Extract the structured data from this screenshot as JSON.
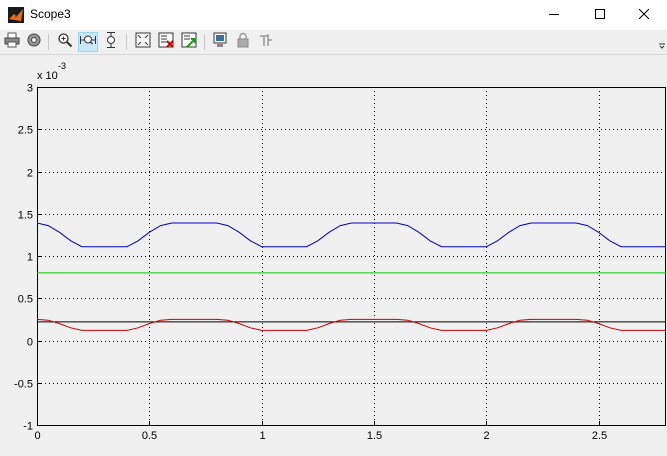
{
  "window": {
    "title": "Scope3",
    "icon": "matlab-icon",
    "controls": [
      "minimize-icon",
      "maximize-icon",
      "close-icon"
    ]
  },
  "toolbar": {
    "buttons": [
      {
        "name": "print-icon"
      },
      {
        "name": "parameters-gear-icon"
      },
      {
        "name": "zoom-in-icon"
      },
      {
        "name": "zoom-x-axis-icon",
        "active": true
      },
      {
        "name": "zoom-y-axis-icon"
      },
      {
        "name": "autoscale-icon"
      },
      {
        "name": "save-axes-settings-icon"
      },
      {
        "name": "restore-axes-settings-icon"
      },
      {
        "name": "floating-scope-icon"
      },
      {
        "name": "lock-axes-icon"
      },
      {
        "name": "signal-selection-icon"
      }
    ]
  },
  "chart_data": {
    "type": "line",
    "exponent_label": "x 10",
    "exponent_power": "-3",
    "xlim": [
      0,
      2.8
    ],
    "ylim": [
      -1,
      3
    ],
    "xticks": [
      "0",
      "0.5",
      "1",
      "1.5",
      "2",
      "2.5"
    ],
    "yticks": [
      "-1",
      "-0.5",
      "0",
      "0.5",
      "1",
      "1.5",
      "2",
      "2.5",
      "3"
    ],
    "grid": true,
    "series": [
      {
        "color": "#0000cc",
        "x": [
          0,
          0.05,
          0.1,
          0.15,
          0.2,
          0.4,
          0.45,
          0.5,
          0.55,
          0.6,
          0.8,
          0.85,
          0.9,
          0.95,
          1.0,
          1.2,
          1.25,
          1.3,
          1.35,
          1.4,
          1.6,
          1.65,
          1.7,
          1.75,
          1.8,
          2.0,
          2.05,
          2.1,
          2.15,
          2.2,
          2.4,
          2.45,
          2.5,
          2.55,
          2.6,
          2.8
        ],
        "y": [
          1.39,
          1.36,
          1.28,
          1.18,
          1.11,
          1.11,
          1.18,
          1.28,
          1.36,
          1.39,
          1.39,
          1.36,
          1.28,
          1.18,
          1.11,
          1.11,
          1.18,
          1.28,
          1.36,
          1.39,
          1.39,
          1.36,
          1.28,
          1.18,
          1.11,
          1.11,
          1.18,
          1.28,
          1.36,
          1.39,
          1.39,
          1.36,
          1.28,
          1.18,
          1.11,
          1.11
        ]
      },
      {
        "color": "#00cc00",
        "x": [
          0,
          2.8
        ],
        "y": [
          0.8,
          0.8
        ]
      },
      {
        "color": "#000000",
        "x": [
          0,
          2.8
        ],
        "y": [
          0.22,
          0.22
        ]
      },
      {
        "color": "#cc0000",
        "x": [
          0,
          0.05,
          0.1,
          0.15,
          0.2,
          0.4,
          0.45,
          0.5,
          0.55,
          0.6,
          0.8,
          0.85,
          0.9,
          0.95,
          1.0,
          1.2,
          1.25,
          1.3,
          1.35,
          1.4,
          1.6,
          1.65,
          1.7,
          1.75,
          1.8,
          2.0,
          2.05,
          2.1,
          2.15,
          2.2,
          2.4,
          2.45,
          2.5,
          2.55,
          2.6,
          2.8
        ],
        "y": [
          0.25,
          0.24,
          0.2,
          0.15,
          0.12,
          0.12,
          0.15,
          0.2,
          0.24,
          0.25,
          0.25,
          0.24,
          0.2,
          0.15,
          0.12,
          0.12,
          0.15,
          0.2,
          0.24,
          0.25,
          0.25,
          0.24,
          0.2,
          0.15,
          0.12,
          0.12,
          0.15,
          0.2,
          0.24,
          0.25,
          0.25,
          0.24,
          0.2,
          0.15,
          0.12,
          0.12
        ]
      }
    ]
  }
}
